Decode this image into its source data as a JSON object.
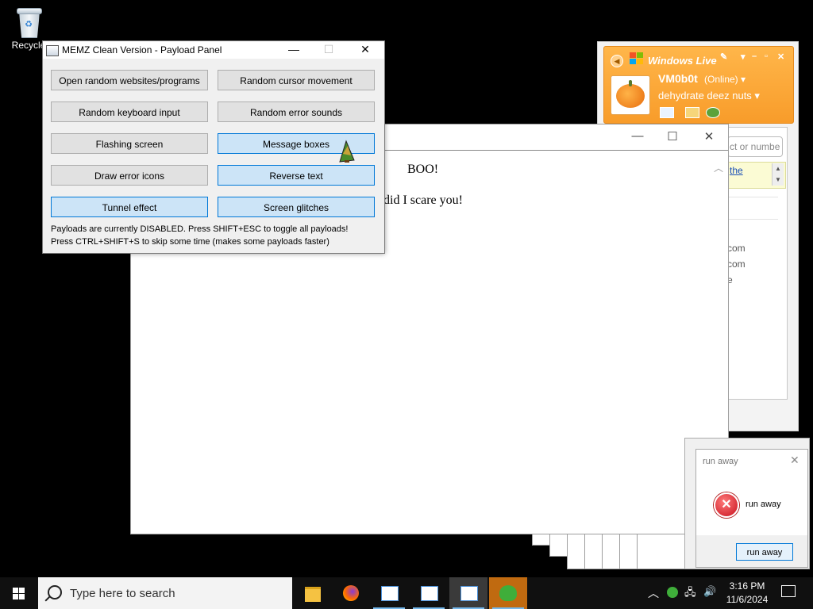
{
  "desktop": {
    "recycle_label": "Recycle"
  },
  "memz": {
    "title": "MEMZ Clean Version - Payload Panel",
    "buttons": [
      {
        "label": "Open random websites/programs",
        "active": false
      },
      {
        "label": "Random cursor movement",
        "active": false
      },
      {
        "label": "Random keyboard input",
        "active": false
      },
      {
        "label": "Random error sounds",
        "active": false
      },
      {
        "label": "Flashing screen",
        "active": false
      },
      {
        "label": "Message boxes",
        "active": true
      },
      {
        "label": "Draw error icons",
        "active": false
      },
      {
        "label": "Reverse text",
        "active": true
      },
      {
        "label": "Tunnel effect",
        "active": true
      },
      {
        "label": "Screen glitches",
        "active": true
      }
    ],
    "note1": "Payloads are currently DISABLED. Press SHIFT+ESC to toggle all payloads!",
    "note2": "Press CTRL+SHIFT+S to skip some time (makes some payloads faster)"
  },
  "boo_window": {
    "heading": "BOO!",
    "subtext": "did I scare you!"
  },
  "messenger": {
    "title": "Windows Live",
    "username": "VM0b0t",
    "status": "(Online)",
    "personal_message": "dehydrate deez nuts",
    "search_placeholder": "ct or numbe",
    "ad_link": "the",
    "rows": [
      "com",
      "com",
      "e"
    ]
  },
  "run_away": {
    "title": "run away",
    "message": "run away",
    "button": "run away"
  },
  "taskbar": {
    "search_placeholder": "Type here to search",
    "time": "3:16 PM",
    "date": "11/6/2024"
  }
}
